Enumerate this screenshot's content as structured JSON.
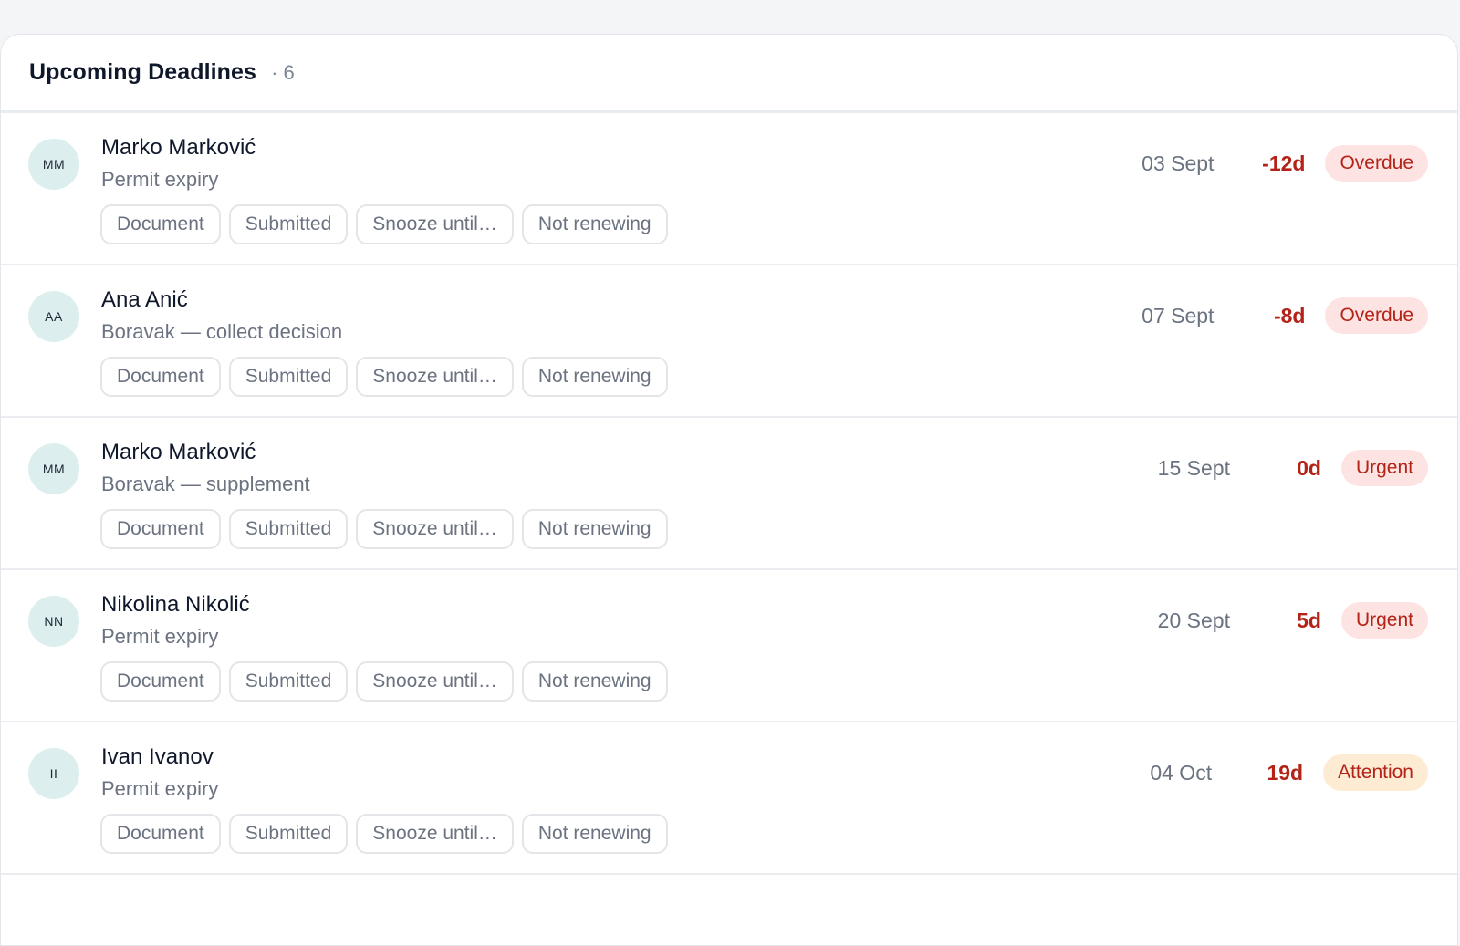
{
  "header": {
    "title": "Upcoming Deadlines",
    "count": "· 6"
  },
  "rows": [
    {
      "initials": "MM",
      "name": "Marko Marković",
      "subtitle": "Permit expiry",
      "date": "03 Sept",
      "days": "-12d",
      "status": "Overdue",
      "status_kind": "overdue",
      "actions": [
        "Document",
        "Submitted",
        "Snooze until…",
        "Not renewing"
      ]
    },
    {
      "initials": "AA",
      "name": "Ana Anić",
      "subtitle": "Boravak — collect decision",
      "date": "07 Sept",
      "days": "-8d",
      "status": "Overdue",
      "status_kind": "overdue",
      "actions": [
        "Document",
        "Submitted",
        "Snooze until…",
        "Not renewing"
      ]
    },
    {
      "initials": "MM",
      "name": "Marko Marković",
      "subtitle": "Boravak — supplement",
      "date": "15 Sept",
      "days": "0d",
      "status": "Urgent",
      "status_kind": "urgent",
      "actions": [
        "Document",
        "Submitted",
        "Snooze until…",
        "Not renewing"
      ]
    },
    {
      "initials": "NN",
      "name": "Nikolina Nikolić",
      "subtitle": "Permit expiry",
      "date": "20 Sept",
      "days": "5d",
      "status": "Urgent",
      "status_kind": "urgent",
      "actions": [
        "Document",
        "Submitted",
        "Snooze until…",
        "Not renewing"
      ]
    },
    {
      "initials": "II",
      "name": "Ivan Ivanov",
      "subtitle": "Permit expiry",
      "date": "04 Oct",
      "days": "19d",
      "status": "Attention",
      "status_kind": "attention",
      "actions": [
        "Document",
        "Submitted",
        "Snooze until…",
        "Not renewing"
      ]
    }
  ],
  "colors": {
    "danger_text": "#b42318",
    "overdue_bg": "#fde4e2",
    "attention_bg": "#fdebd3",
    "avatar_bg": "#dcefee"
  }
}
